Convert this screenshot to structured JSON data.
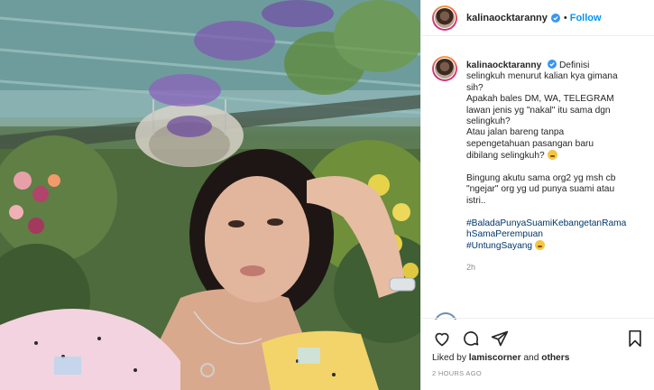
{
  "post": {
    "username": "kalinaocktaranny",
    "follow_label": "Follow",
    "dot": "•",
    "caption": {
      "line1": "Definisi",
      "line2": "selingkuh menurut kalian kya gimana",
      "line3": "sih?",
      "line4": "Apakah bales DM, WA, TELEGRAM",
      "line5": "lawan jenis yg \"nakal\" itu sama dgn",
      "line6": "selingkuh?",
      "line7": "Atau jalan bareng tanpa",
      "line8": "sepengetahuan pasangan baru",
      "line9": "dibilang selingkuh?",
      "line10": "Bingung akutu sama org2 yg msh cb",
      "line11": "\"ngejar\" org yg ud punya suami atau",
      "line12": "istri..",
      "hashtag1a": "#BaladaPunyaSuamiKebangetanRama",
      "hashtag1b": "hSamaPerempuan",
      "hashtag2": "#UntungSayang"
    },
    "caption_time": "2h",
    "likes_prefix": "Liked by ",
    "likes_user": "lamiscorner",
    "likes_suffix": " and ",
    "likes_others": "others",
    "timestamp": "2 HOURS AGO"
  },
  "icons": {
    "verified": "verified-badge-icon",
    "like": "heart-icon",
    "comment": "comment-icon",
    "share": "paper-plane-icon",
    "save": "bookmark-icon",
    "emoji_think": "thinking-face-emoji",
    "emoji_smile": "smiling-face-emoji"
  },
  "colors": {
    "link_blue": "#0095f6",
    "hashtag": "#00376b",
    "muted": "#8e8e8e",
    "text": "#262626"
  }
}
